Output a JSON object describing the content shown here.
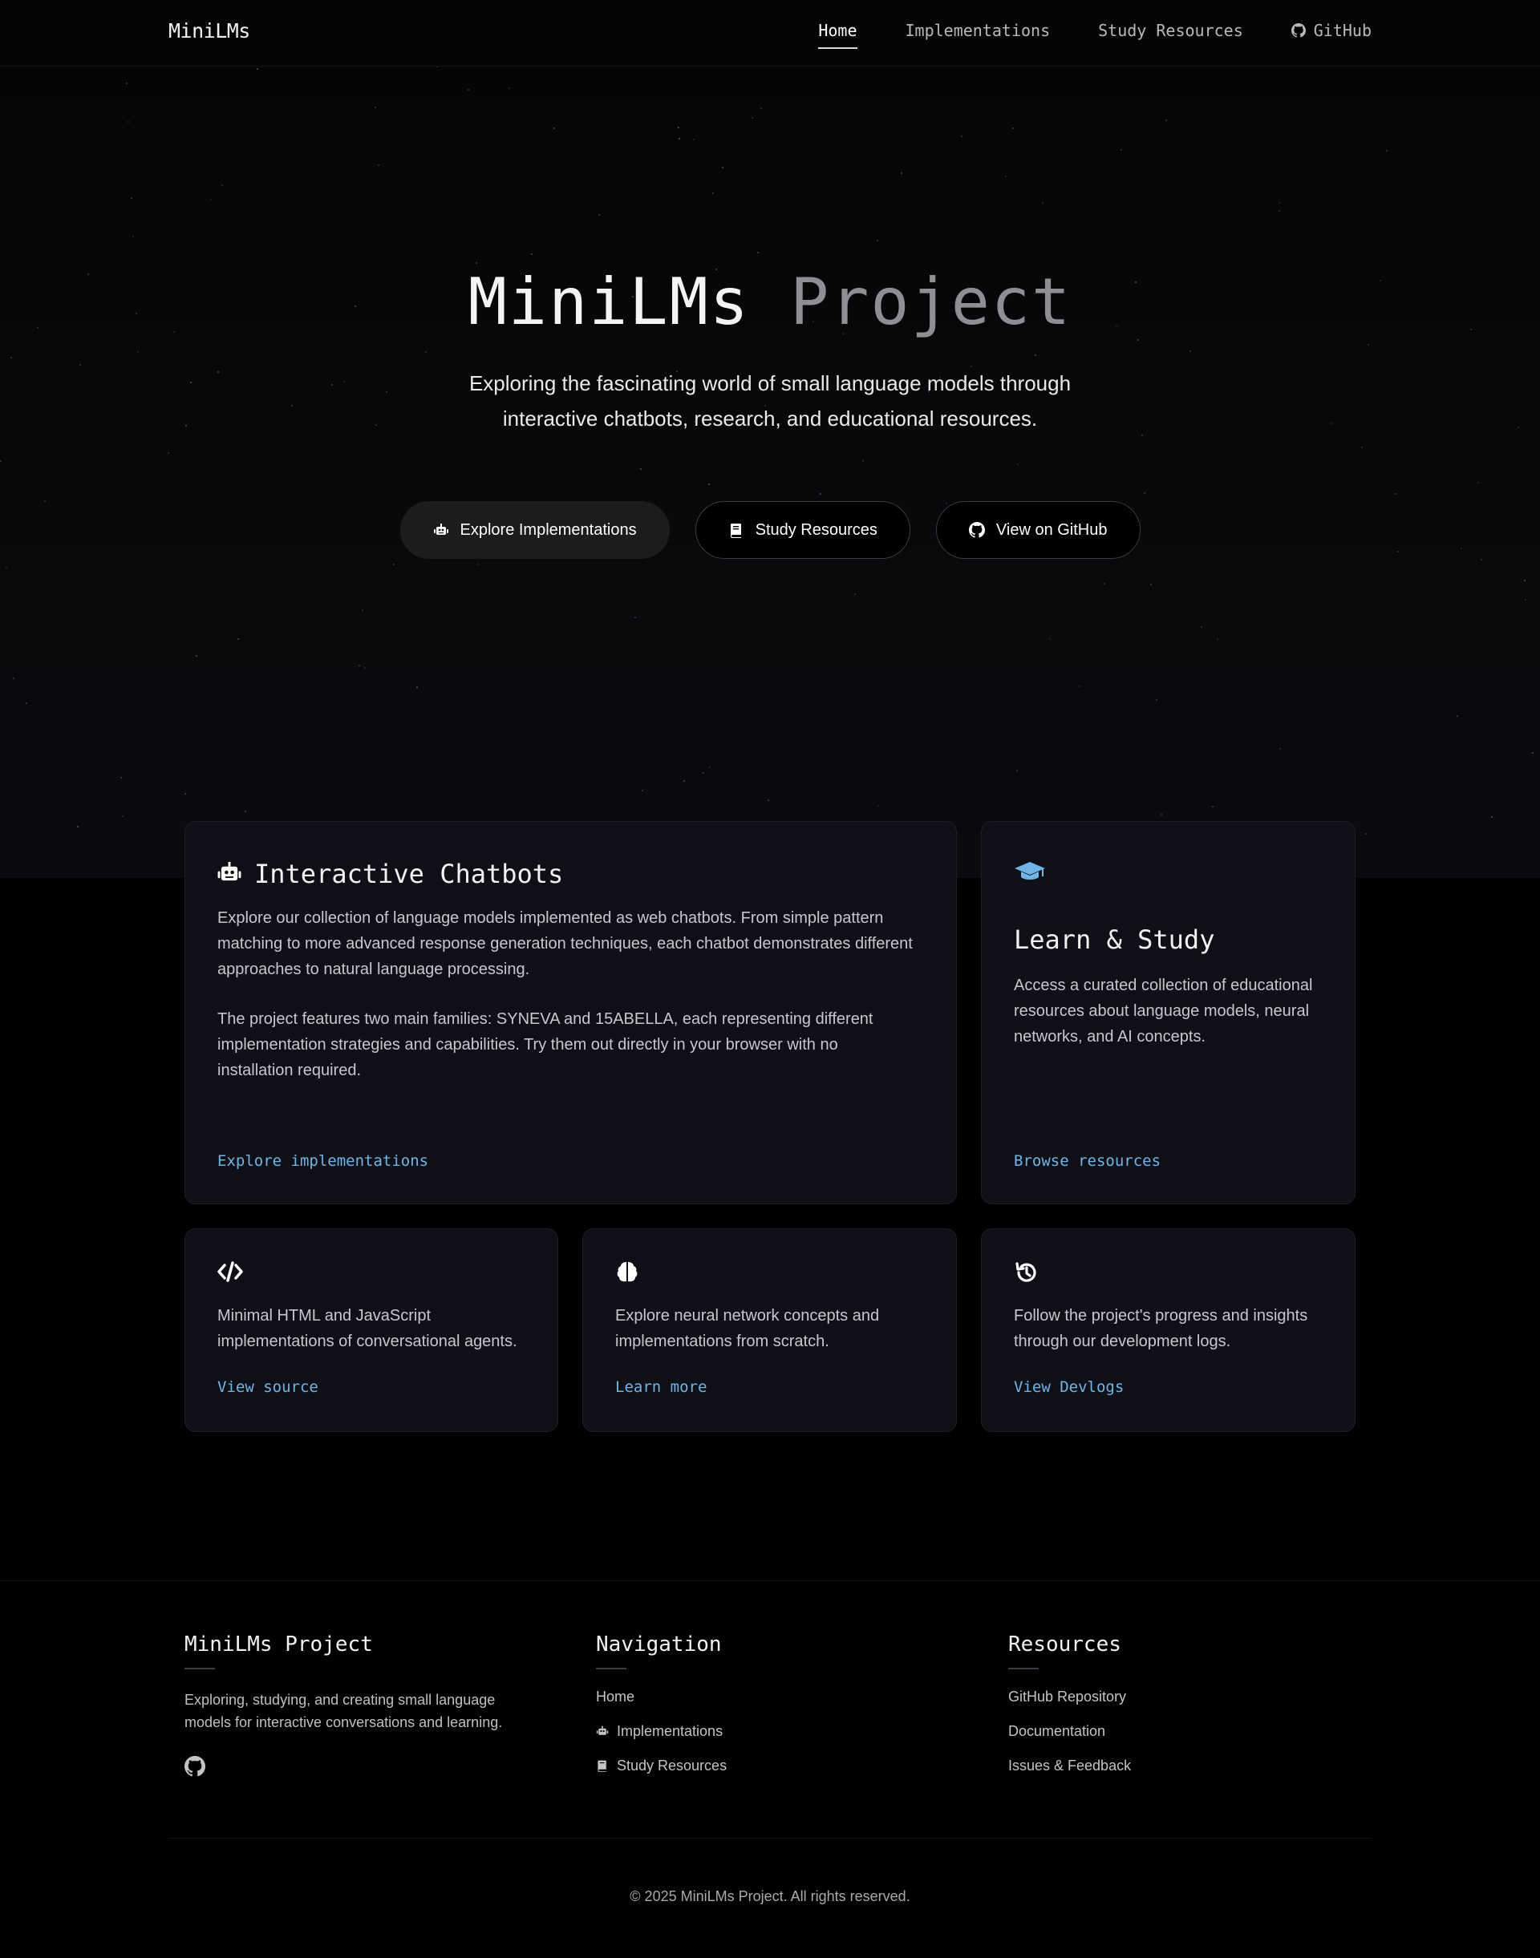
{
  "nav": {
    "brand": "MiniLMs",
    "links": [
      {
        "label": "Home",
        "active": true
      },
      {
        "label": "Implementations"
      },
      {
        "label": "Study Resources"
      },
      {
        "label": "GitHub",
        "icon": "github-icon"
      }
    ]
  },
  "hero": {
    "title_part1": "MiniLMs",
    "title_part2": "Project",
    "subtitle": "Exploring the fascinating world of small language models through interactive chatbots, research, and educational resources.",
    "buttons": [
      {
        "label": "Explore Implementations",
        "icon": "robot-icon"
      },
      {
        "label": "Study Resources",
        "icon": "book-icon"
      },
      {
        "label": "View on GitHub",
        "icon": "github-icon"
      }
    ]
  },
  "cards": {
    "chatbots": {
      "title": "Interactive Chatbots",
      "icon": "robot-icon",
      "paragraph1": "Explore our collection of language models implemented as web chatbots. From simple pattern matching to more advanced response generation techniques, each chatbot demonstrates different approaches to natural language processing.",
      "paragraph2": "The project features two main families: SYNEVA and 15ABELLA, each representing different implementation strategies and capabilities. Try them out directly in your browser with no installation required.",
      "link": "Explore implementations"
    },
    "learn": {
      "title": "Learn & Study",
      "icon": "graduation-cap-icon",
      "text": "Access a curated collection of educational resources about language models, neural networks, and AI concepts.",
      "link": "Browse resources"
    },
    "code": {
      "icon": "code-icon",
      "text": "Minimal HTML and JavaScript implementations of conversational agents.",
      "link": "View source"
    },
    "neural": {
      "icon": "brain-icon",
      "text": "Explore neural network concepts and implementations from scratch.",
      "link": "Learn more"
    },
    "devlogs": {
      "icon": "history-icon",
      "text": "Follow the project's progress and insights through our development logs.",
      "link": "View Devlogs"
    }
  },
  "footer": {
    "about": {
      "title": "MiniLMs Project",
      "text": "Exploring, studying, and creating small language models for interactive conversations and learning."
    },
    "navigation": {
      "title": "Navigation",
      "items": [
        "Home",
        "Implementations",
        "Study Resources"
      ]
    },
    "resources": {
      "title": "Resources",
      "items": [
        "GitHub Repository",
        "Documentation",
        "Issues & Feedback"
      ]
    },
    "copyright": "© 2025 MiniLMs Project. All rights reserved."
  },
  "colors": {
    "accent_link": "#6fb5e6",
    "card_bg": "#0f0f17",
    "page_bg": "#000000"
  }
}
